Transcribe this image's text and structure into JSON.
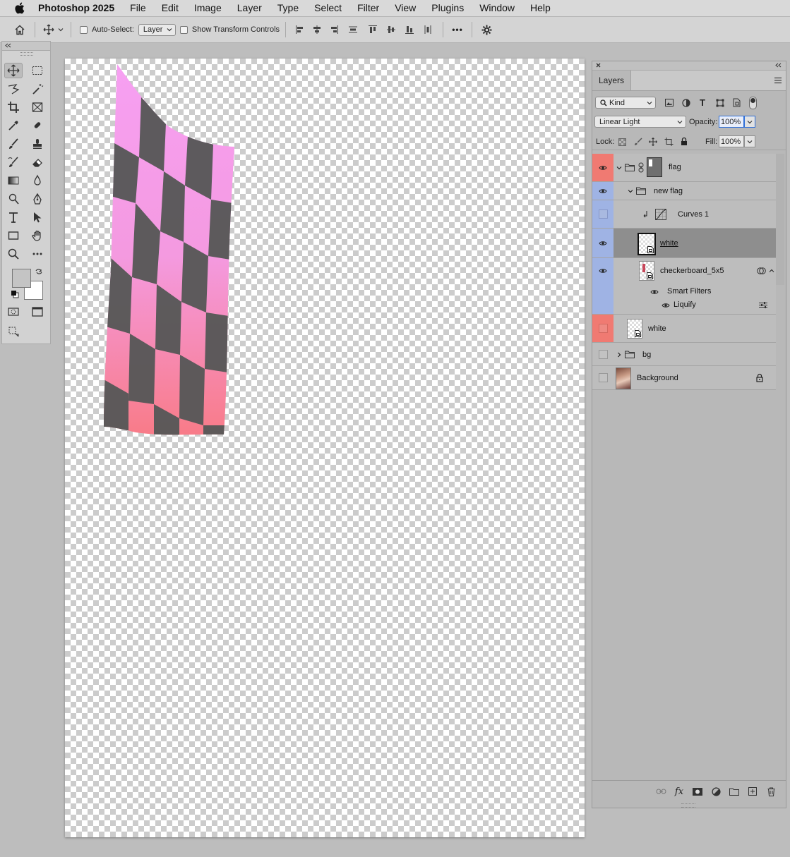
{
  "menubar": {
    "app_name": "Photoshop 2025",
    "items": [
      "File",
      "Edit",
      "Image",
      "Layer",
      "Type",
      "Select",
      "Filter",
      "View",
      "Plugins",
      "Window",
      "Help"
    ]
  },
  "options_bar": {
    "auto_select_label": "Auto-Select:",
    "auto_select_value": "Layer",
    "show_transform_label": "Show Transform Controls",
    "more_label": "•••"
  },
  "layers_panel": {
    "tab_label": "Layers",
    "filter_kind": "Kind",
    "blend_mode": "Linear Light",
    "opacity_label": "Opacity:",
    "opacity_value": "100%",
    "lock_label": "Lock:",
    "fill_label": "Fill:",
    "fill_value": "100%",
    "layers": [
      {
        "name": "flag",
        "type": "group",
        "visible": true,
        "label_color": "#f07a72"
      },
      {
        "name": "new flag",
        "type": "group",
        "visible": true,
        "label_color": "#9fb3e4"
      },
      {
        "name": "Curves 1",
        "type": "adjustment",
        "visible": false,
        "label_color": "#9fb3e4"
      },
      {
        "name": "white",
        "type": "smart",
        "visible": true,
        "selected": true,
        "label_color": "#9fb3e4"
      },
      {
        "name": "checkerboard_5x5",
        "type": "smart",
        "visible": true,
        "label_color": "#9fb3e4"
      },
      {
        "name": "Smart Filters",
        "type": "sub"
      },
      {
        "name": "Liquify",
        "type": "sub"
      },
      {
        "name": "white",
        "type": "smart",
        "visible": false,
        "label_color": "#f07a72"
      },
      {
        "name": "bg",
        "type": "group",
        "visible": false
      },
      {
        "name": "Background",
        "type": "image",
        "visible": false,
        "locked": true
      }
    ]
  },
  "colors": {
    "flag_pink": "#f07dd6",
    "flag_dark": "#5a5a5a",
    "canvas_checker": "#cccccc"
  }
}
